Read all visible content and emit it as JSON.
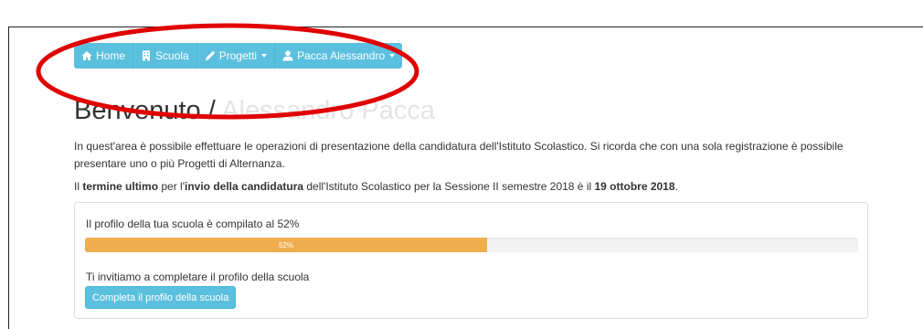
{
  "nav": {
    "items": [
      {
        "label": "Home",
        "icon": "home-icon",
        "dropdown": false
      },
      {
        "label": "Scuola",
        "icon": "building-icon",
        "dropdown": false
      },
      {
        "label": "Progetti",
        "icon": "pencil-icon",
        "dropdown": true
      },
      {
        "label": "Pacca Alessandro",
        "icon": "user-icon",
        "dropdown": true
      }
    ]
  },
  "header": {
    "welcome": "Benvenuto / ",
    "name": "Alessandro Pacca"
  },
  "intro": "In quest'area è possibile effettuare le operazioni di presentazione della candidatura dell'Istituto Scolastico. Si ricorda che con una sola registrazione è possibile presentare uno o più Progetti di Alternanza.",
  "deadline": {
    "part1": "Il ",
    "bold1": "termine ultimo",
    "part2": " per l'",
    "bold2": "invio della candidatura",
    "part3": " dell'Istituto Scolastico per la Sessione II semestre 2018 è il ",
    "bold3": "19 ottobre 2018",
    "part4": "."
  },
  "profile": {
    "status_text": "Il profilo della tua scuola è compilato al 52%",
    "progress_percent": 52,
    "progress_label": "52%",
    "invite_text": "Ti invitiamo a completare il profilo della scuola",
    "button_label": "Completa il profilo della scuola"
  },
  "colors": {
    "nav_bg": "#5bc0de",
    "progress_fill": "#f0ad4e",
    "annotation": "#e00000"
  }
}
